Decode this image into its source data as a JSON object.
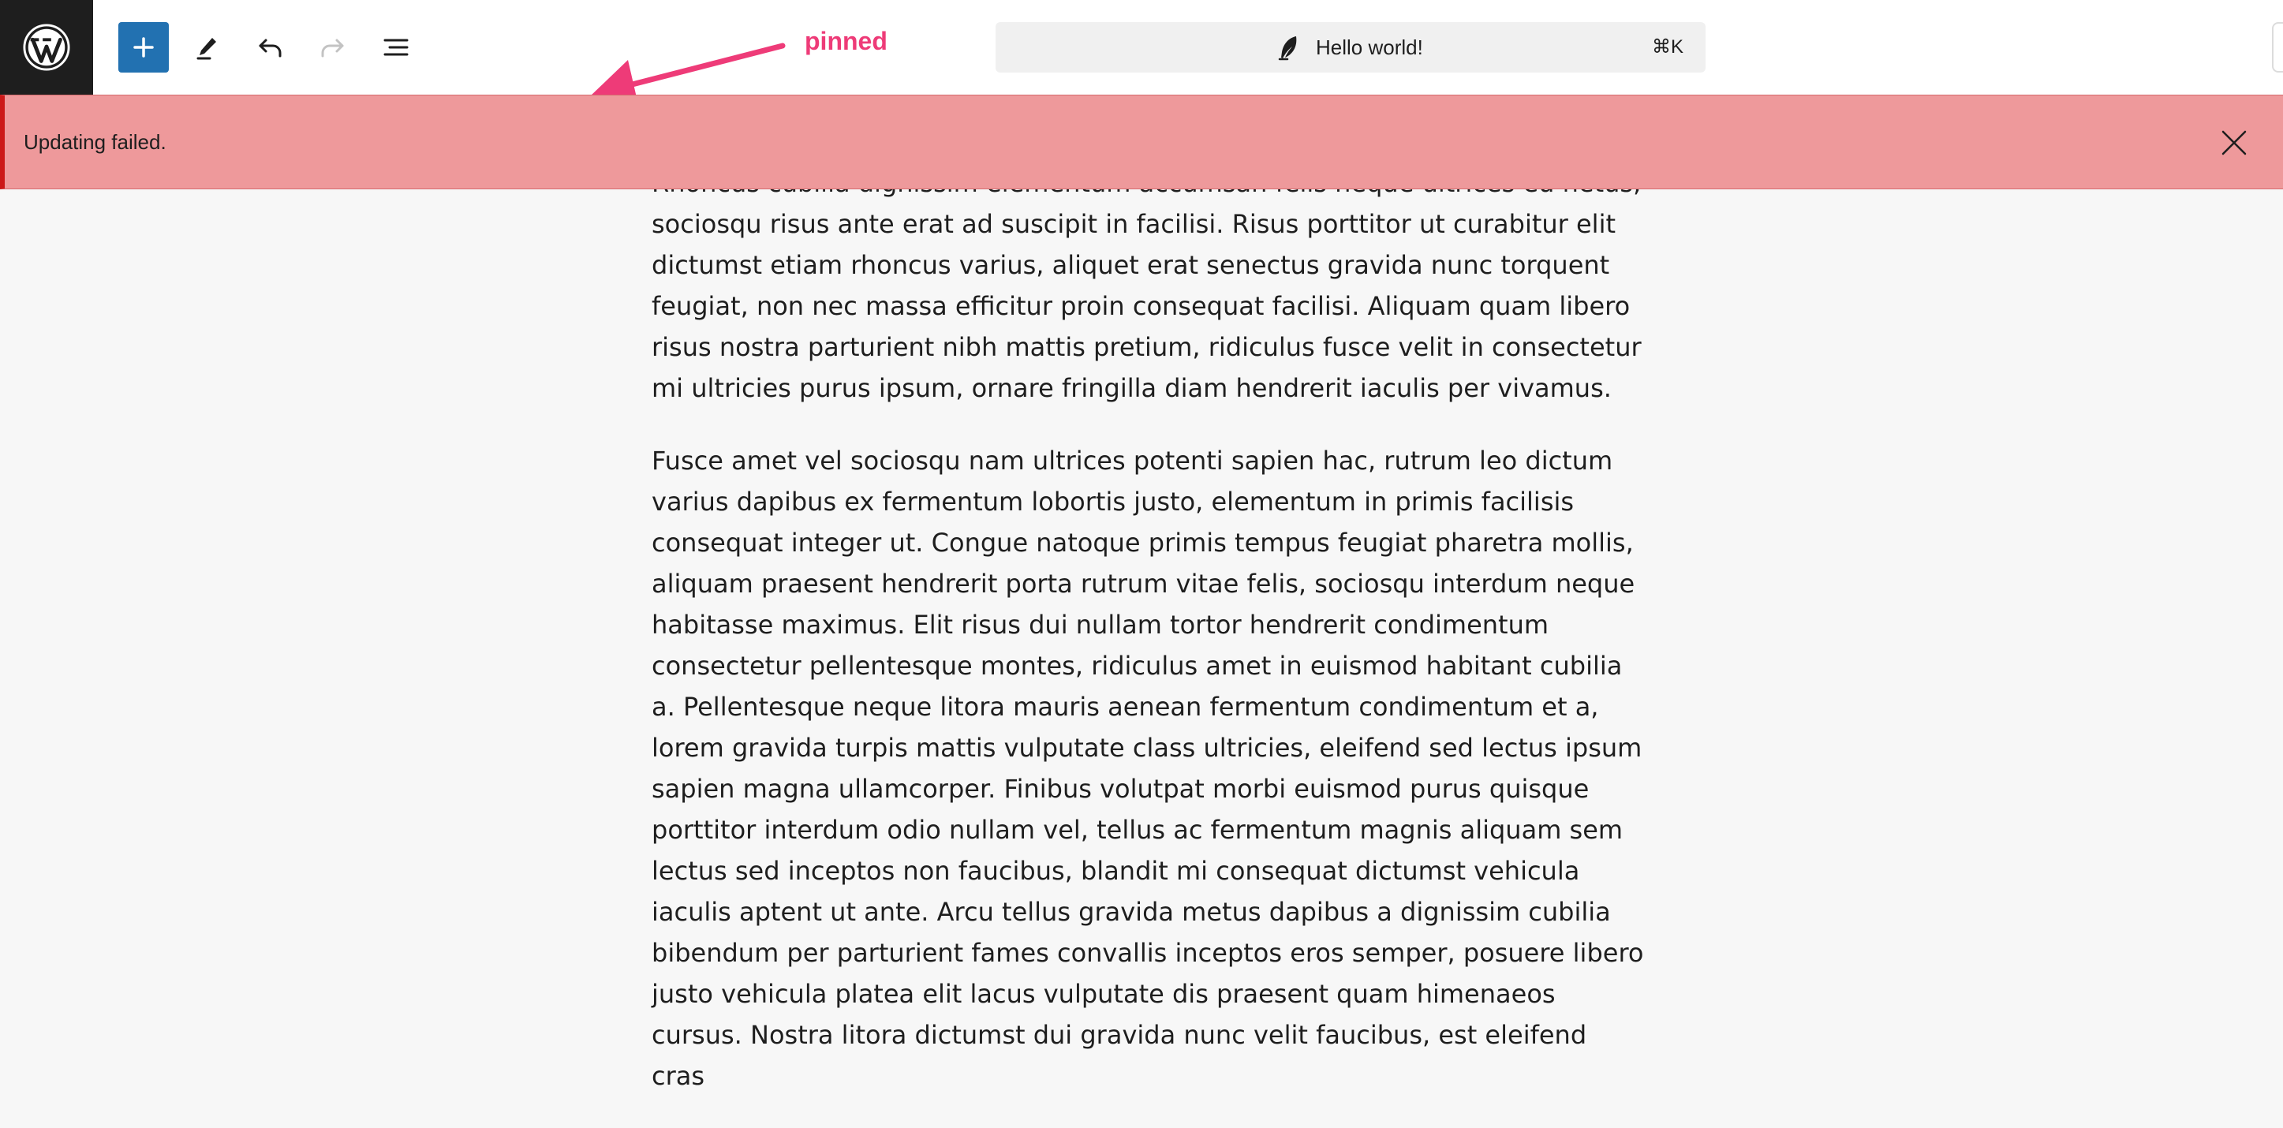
{
  "toolbar": {
    "logo_icon": "wordpress-logo-icon",
    "add_icon": "plus-icon",
    "tools_icon": "pencil-icon",
    "undo_icon": "undo-icon",
    "redo_icon": "redo-icon",
    "list_view_icon": "list-view-icon",
    "accent_color": "#2271b1"
  },
  "annotation": {
    "label": "pinned",
    "color": "#ee3b78"
  },
  "command_bar": {
    "icon": "feather-icon",
    "title": "Hello world!",
    "shortcut": "⌘K"
  },
  "notice": {
    "message": "Updating failed.",
    "dismiss_icon": "close-icon",
    "background": "#ee999b",
    "border_color": "#cc1818"
  },
  "content": {
    "paragraphs": [
      "Rhoncus cubilia dignissim elementum accumsan felis neque ultrices eu netus, sociosqu risus ante erat ad suscipit in facilisi. Risus porttitor ut curabitur elit dictumst etiam rhoncus varius, aliquet erat senectus gravida nunc torquent feugiat, non nec massa efficitur proin consequat facilisi. Aliquam quam libero risus nostra parturient nibh mattis pretium, ridiculus fusce velit in consectetur mi ultricies purus ipsum, ornare fringilla diam hendrerit iaculis per vivamus.",
      "Fusce amet vel sociosqu nam ultrices potenti sapien hac, rutrum leo dictum varius dapibus ex fermentum lobortis justo, elementum in primis facilisis consequat integer ut. Congue natoque primis tempus feugiat pharetra mollis, aliquam praesent hendrerit porta rutrum vitae felis, sociosqu interdum neque habitasse maximus. Elit risus dui nullam tortor hendrerit condimentum consectetur pellentesque montes, ridiculus amet in euismod habitant cubilia a. Pellentesque neque litora mauris aenean fermentum condimentum et a, lorem gravida turpis mattis vulputate class ultricies, eleifend sed lectus ipsum sapien magna ullamcorper. Finibus volutpat morbi euismod purus quisque porttitor interdum odio nullam vel, tellus ac fermentum magnis aliquam sem lectus sed inceptos non faucibus, blandit mi consequat dictumst vehicula iaculis aptent ut ante. Arcu tellus gravida metus dapibus a dignissim cubilia bibendum per parturient fames convallis inceptos eros semper, posuere libero justo vehicula platea elit lacus vulputate dis praesent quam himenaeos cursus. Nostra litora dictumst dui gravida nunc velit faucibus, est eleifend cras"
    ]
  }
}
